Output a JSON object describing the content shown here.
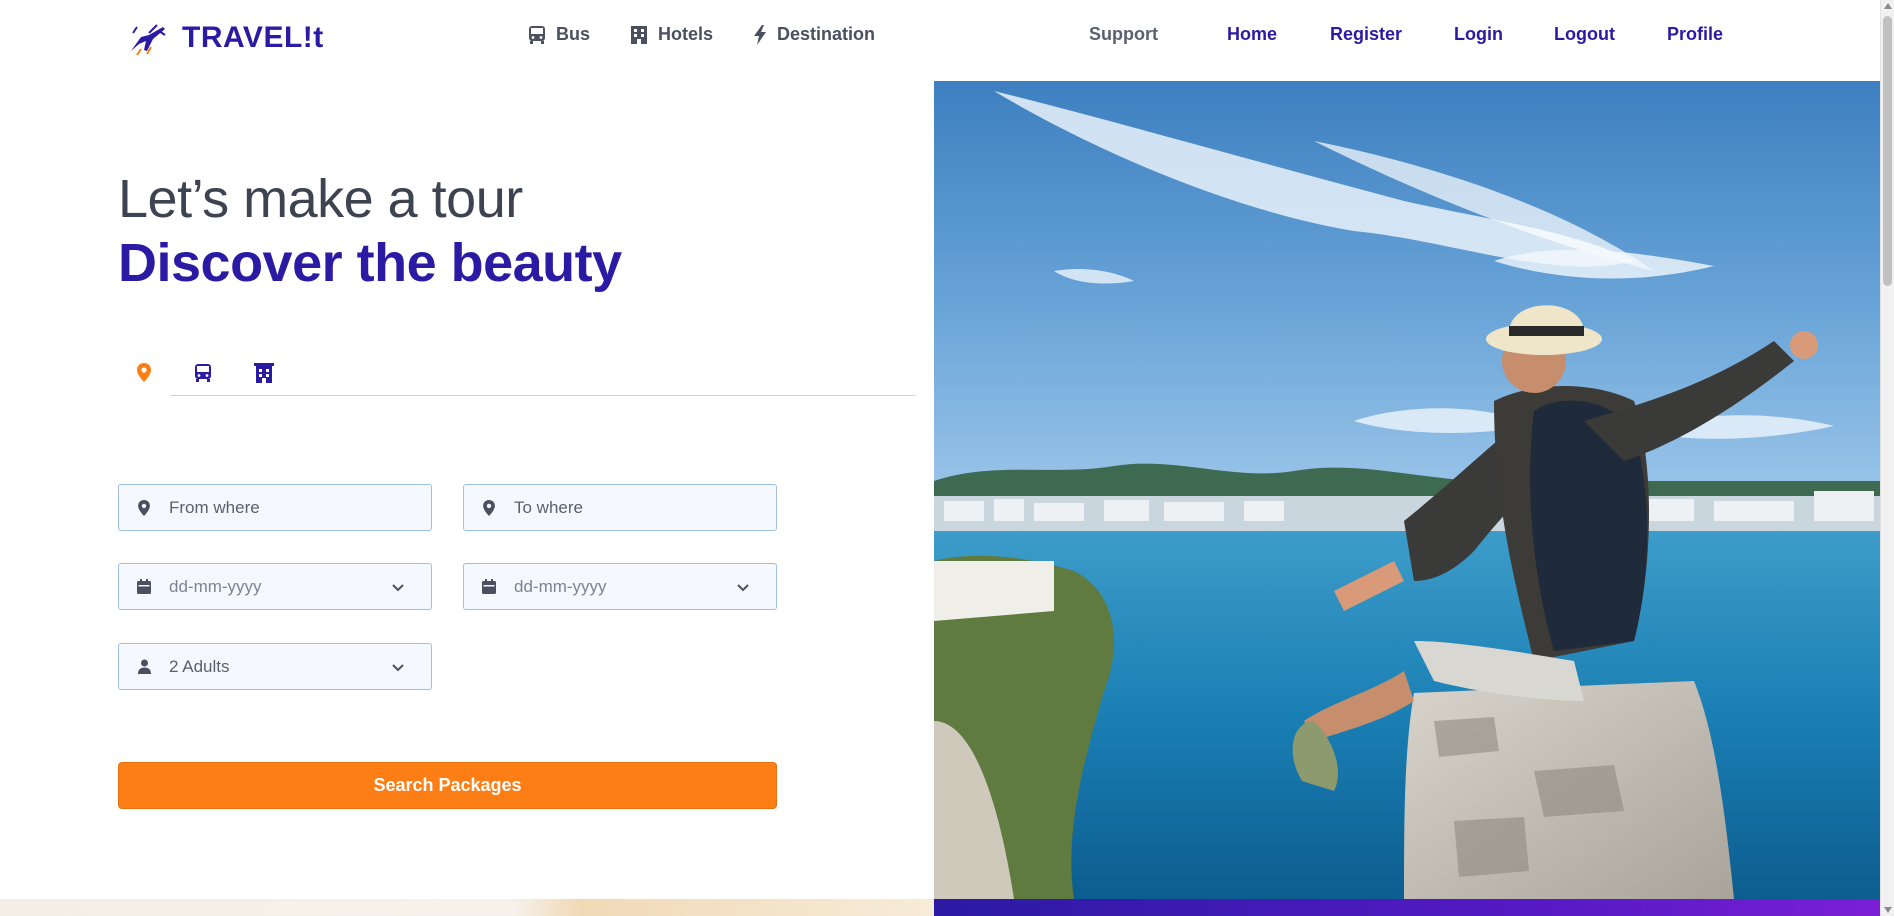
{
  "brand": {
    "name": "TRAVEL!t",
    "logo_icon": "airplane-logo-icon"
  },
  "topnav": [
    {
      "label": "Bus",
      "icon": "bus-icon"
    },
    {
      "label": "Hotels",
      "icon": "hotel-building-icon"
    },
    {
      "label": "Destination",
      "icon": "lightning-icon"
    }
  ],
  "rightnav": {
    "support": "Support",
    "home": "Home",
    "register": "Register",
    "login": "Login",
    "logout": "Logout",
    "profile": "Profile"
  },
  "hero": {
    "line1": "Let’s make a tour",
    "line2": "Discover the beauty"
  },
  "tabs": [
    {
      "name": "location-tab",
      "icon": "map-pin-icon",
      "active": true
    },
    {
      "name": "bus-tab",
      "icon": "bus-icon",
      "active": false
    },
    {
      "name": "hotel-tab",
      "icon": "hotel-building-icon",
      "active": false
    }
  ],
  "form": {
    "from_placeholder": "From where",
    "to_placeholder": "To where",
    "depart_date": "dd-mm-yyyy",
    "return_date": "dd-mm-yyyy",
    "travellers": "2 Adults",
    "search_label": "Search Packages"
  },
  "colors": {
    "brand": "#2b1aa3",
    "accent": "#fd7e14",
    "field_border": "#9fc0e0",
    "field_bg": "#f5f9ff"
  },
  "image": {
    "alt": "Traveler with hat and backpack sitting on a stone wall overlooking a blue bay and coastal town"
  }
}
